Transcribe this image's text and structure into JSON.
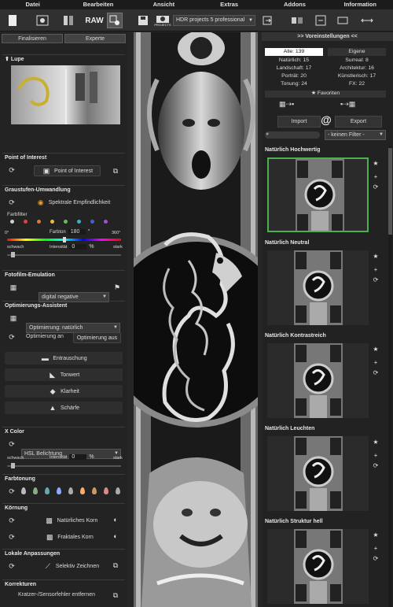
{
  "menu": [
    "Datei",
    "Bearbeiten",
    "Ansicht",
    "Extras",
    "Addons",
    "Information"
  ],
  "toolbar": {
    "raw_label": "RAW",
    "projects_label": "PROJECTS",
    "preset_select": "HDR projects 5 professional"
  },
  "left": {
    "tabs": [
      "Finalisieren",
      "Experte"
    ],
    "lupe": {
      "title": "Lupe"
    },
    "poi": {
      "title": "Point of Interest",
      "button": "Point of Interest"
    },
    "gray": {
      "title": "Graustufen-Umwandlung",
      "button": "Spektrale Empfindlichkeit",
      "filter_label": "Farbfilter",
      "hue_label": "Farbton",
      "hue_value": "180",
      "hue_unit": "°",
      "range_min": "0°",
      "range_max": "360°",
      "weak": "schwach",
      "strong": "stark",
      "intensity_label": "Intensität",
      "intensity_value": "0",
      "intensity_unit": "%"
    },
    "film": {
      "title": "Fotofilm-Emulation",
      "select": "digital negative"
    },
    "opt": {
      "title": "Optimierungs-Assistent",
      "select": "Optimierung: natürlich",
      "on": "Optimierung an",
      "off": "Optimierung aus",
      "items": [
        "Entrauschung",
        "Tonwert",
        "Klarheit",
        "Schärfe"
      ]
    },
    "xcolor": {
      "title": "X Color",
      "select": "HSL Belichtung",
      "weak": "schwach",
      "strong": "stark",
      "intensity_label": "Intensität",
      "intensity_value": "0",
      "intensity_unit": "%"
    },
    "toning": {
      "title": "Farbtonung"
    },
    "grain": {
      "title": "Körnung",
      "natural": "Natürliches Korn",
      "fractal": "Fraktales Korn"
    },
    "local": {
      "title": "Lokale Anpassungen",
      "button": "Selektiv Zeichnen"
    },
    "corr": {
      "title": "Korrekturen",
      "button": "Kratzer-/Sensorfehler entfernen"
    }
  },
  "right": {
    "title": ">> Voreinstellungen <<",
    "cats": [
      [
        "Alle: 139",
        "Eigene"
      ],
      [
        "Natürlich: 15",
        "Surreal: 8"
      ],
      [
        "Landschaft: 17",
        "Architektur: 16"
      ],
      [
        "Porträt: 20",
        "Künstlerisch: 17"
      ],
      [
        "Tonung: 24",
        "FX: 22"
      ]
    ],
    "favorites": "Favoriten",
    "import": "Import",
    "export": "Export",
    "filter": "- keinen Filter -",
    "presets": [
      "Natürlich Hochwertig",
      "Natürlich Neutral",
      "Natürlich Kontrastreich",
      "Natürlich Leuchten",
      "Natürlich Struktur hell"
    ]
  },
  "colors": {
    "accent": "#4caf50",
    "filter_dots": [
      "#d0d0d0",
      "#e04040",
      "#e07a30",
      "#e0c040",
      "#60c050",
      "#40b0c0",
      "#4060e0",
      "#a050d0"
    ]
  }
}
